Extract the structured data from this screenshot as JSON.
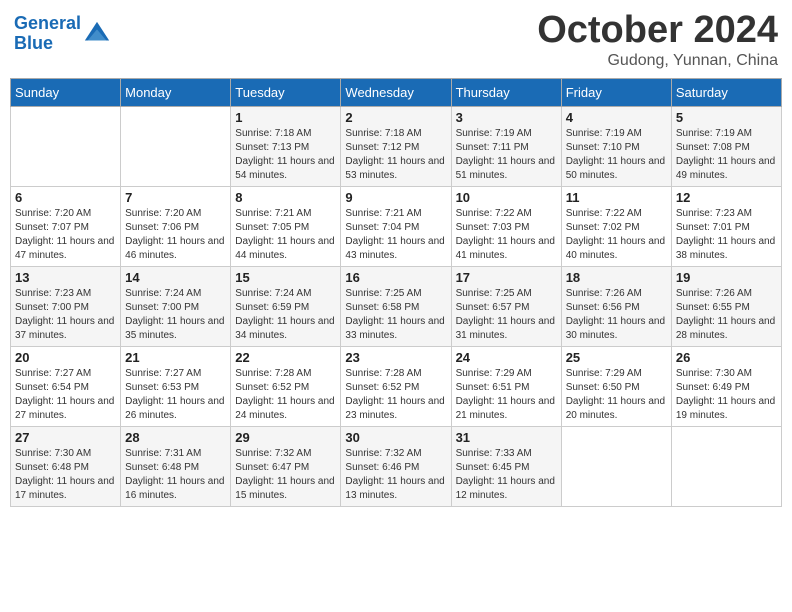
{
  "header": {
    "logo_line1": "General",
    "logo_line2": "Blue",
    "month": "October 2024",
    "location": "Gudong, Yunnan, China"
  },
  "weekdays": [
    "Sunday",
    "Monday",
    "Tuesday",
    "Wednesday",
    "Thursday",
    "Friday",
    "Saturday"
  ],
  "weeks": [
    [
      {
        "day": null
      },
      {
        "day": null
      },
      {
        "day": 1,
        "sunrise": "Sunrise: 7:18 AM",
        "sunset": "Sunset: 7:13 PM",
        "daylight": "Daylight: 11 hours and 54 minutes."
      },
      {
        "day": 2,
        "sunrise": "Sunrise: 7:18 AM",
        "sunset": "Sunset: 7:12 PM",
        "daylight": "Daylight: 11 hours and 53 minutes."
      },
      {
        "day": 3,
        "sunrise": "Sunrise: 7:19 AM",
        "sunset": "Sunset: 7:11 PM",
        "daylight": "Daylight: 11 hours and 51 minutes."
      },
      {
        "day": 4,
        "sunrise": "Sunrise: 7:19 AM",
        "sunset": "Sunset: 7:10 PM",
        "daylight": "Daylight: 11 hours and 50 minutes."
      },
      {
        "day": 5,
        "sunrise": "Sunrise: 7:19 AM",
        "sunset": "Sunset: 7:08 PM",
        "daylight": "Daylight: 11 hours and 49 minutes."
      }
    ],
    [
      {
        "day": 6,
        "sunrise": "Sunrise: 7:20 AM",
        "sunset": "Sunset: 7:07 PM",
        "daylight": "Daylight: 11 hours and 47 minutes."
      },
      {
        "day": 7,
        "sunrise": "Sunrise: 7:20 AM",
        "sunset": "Sunset: 7:06 PM",
        "daylight": "Daylight: 11 hours and 46 minutes."
      },
      {
        "day": 8,
        "sunrise": "Sunrise: 7:21 AM",
        "sunset": "Sunset: 7:05 PM",
        "daylight": "Daylight: 11 hours and 44 minutes."
      },
      {
        "day": 9,
        "sunrise": "Sunrise: 7:21 AM",
        "sunset": "Sunset: 7:04 PM",
        "daylight": "Daylight: 11 hours and 43 minutes."
      },
      {
        "day": 10,
        "sunrise": "Sunrise: 7:22 AM",
        "sunset": "Sunset: 7:03 PM",
        "daylight": "Daylight: 11 hours and 41 minutes."
      },
      {
        "day": 11,
        "sunrise": "Sunrise: 7:22 AM",
        "sunset": "Sunset: 7:02 PM",
        "daylight": "Daylight: 11 hours and 40 minutes."
      },
      {
        "day": 12,
        "sunrise": "Sunrise: 7:23 AM",
        "sunset": "Sunset: 7:01 PM",
        "daylight": "Daylight: 11 hours and 38 minutes."
      }
    ],
    [
      {
        "day": 13,
        "sunrise": "Sunrise: 7:23 AM",
        "sunset": "Sunset: 7:00 PM",
        "daylight": "Daylight: 11 hours and 37 minutes."
      },
      {
        "day": 14,
        "sunrise": "Sunrise: 7:24 AM",
        "sunset": "Sunset: 7:00 PM",
        "daylight": "Daylight: 11 hours and 35 minutes."
      },
      {
        "day": 15,
        "sunrise": "Sunrise: 7:24 AM",
        "sunset": "Sunset: 6:59 PM",
        "daylight": "Daylight: 11 hours and 34 minutes."
      },
      {
        "day": 16,
        "sunrise": "Sunrise: 7:25 AM",
        "sunset": "Sunset: 6:58 PM",
        "daylight": "Daylight: 11 hours and 33 minutes."
      },
      {
        "day": 17,
        "sunrise": "Sunrise: 7:25 AM",
        "sunset": "Sunset: 6:57 PM",
        "daylight": "Daylight: 11 hours and 31 minutes."
      },
      {
        "day": 18,
        "sunrise": "Sunrise: 7:26 AM",
        "sunset": "Sunset: 6:56 PM",
        "daylight": "Daylight: 11 hours and 30 minutes."
      },
      {
        "day": 19,
        "sunrise": "Sunrise: 7:26 AM",
        "sunset": "Sunset: 6:55 PM",
        "daylight": "Daylight: 11 hours and 28 minutes."
      }
    ],
    [
      {
        "day": 20,
        "sunrise": "Sunrise: 7:27 AM",
        "sunset": "Sunset: 6:54 PM",
        "daylight": "Daylight: 11 hours and 27 minutes."
      },
      {
        "day": 21,
        "sunrise": "Sunrise: 7:27 AM",
        "sunset": "Sunset: 6:53 PM",
        "daylight": "Daylight: 11 hours and 26 minutes."
      },
      {
        "day": 22,
        "sunrise": "Sunrise: 7:28 AM",
        "sunset": "Sunset: 6:52 PM",
        "daylight": "Daylight: 11 hours and 24 minutes."
      },
      {
        "day": 23,
        "sunrise": "Sunrise: 7:28 AM",
        "sunset": "Sunset: 6:52 PM",
        "daylight": "Daylight: 11 hours and 23 minutes."
      },
      {
        "day": 24,
        "sunrise": "Sunrise: 7:29 AM",
        "sunset": "Sunset: 6:51 PM",
        "daylight": "Daylight: 11 hours and 21 minutes."
      },
      {
        "day": 25,
        "sunrise": "Sunrise: 7:29 AM",
        "sunset": "Sunset: 6:50 PM",
        "daylight": "Daylight: 11 hours and 20 minutes."
      },
      {
        "day": 26,
        "sunrise": "Sunrise: 7:30 AM",
        "sunset": "Sunset: 6:49 PM",
        "daylight": "Daylight: 11 hours and 19 minutes."
      }
    ],
    [
      {
        "day": 27,
        "sunrise": "Sunrise: 7:30 AM",
        "sunset": "Sunset: 6:48 PM",
        "daylight": "Daylight: 11 hours and 17 minutes."
      },
      {
        "day": 28,
        "sunrise": "Sunrise: 7:31 AM",
        "sunset": "Sunset: 6:48 PM",
        "daylight": "Daylight: 11 hours and 16 minutes."
      },
      {
        "day": 29,
        "sunrise": "Sunrise: 7:32 AM",
        "sunset": "Sunset: 6:47 PM",
        "daylight": "Daylight: 11 hours and 15 minutes."
      },
      {
        "day": 30,
        "sunrise": "Sunrise: 7:32 AM",
        "sunset": "Sunset: 6:46 PM",
        "daylight": "Daylight: 11 hours and 13 minutes."
      },
      {
        "day": 31,
        "sunrise": "Sunrise: 7:33 AM",
        "sunset": "Sunset: 6:45 PM",
        "daylight": "Daylight: 11 hours and 12 minutes."
      },
      {
        "day": null
      },
      {
        "day": null
      }
    ]
  ]
}
